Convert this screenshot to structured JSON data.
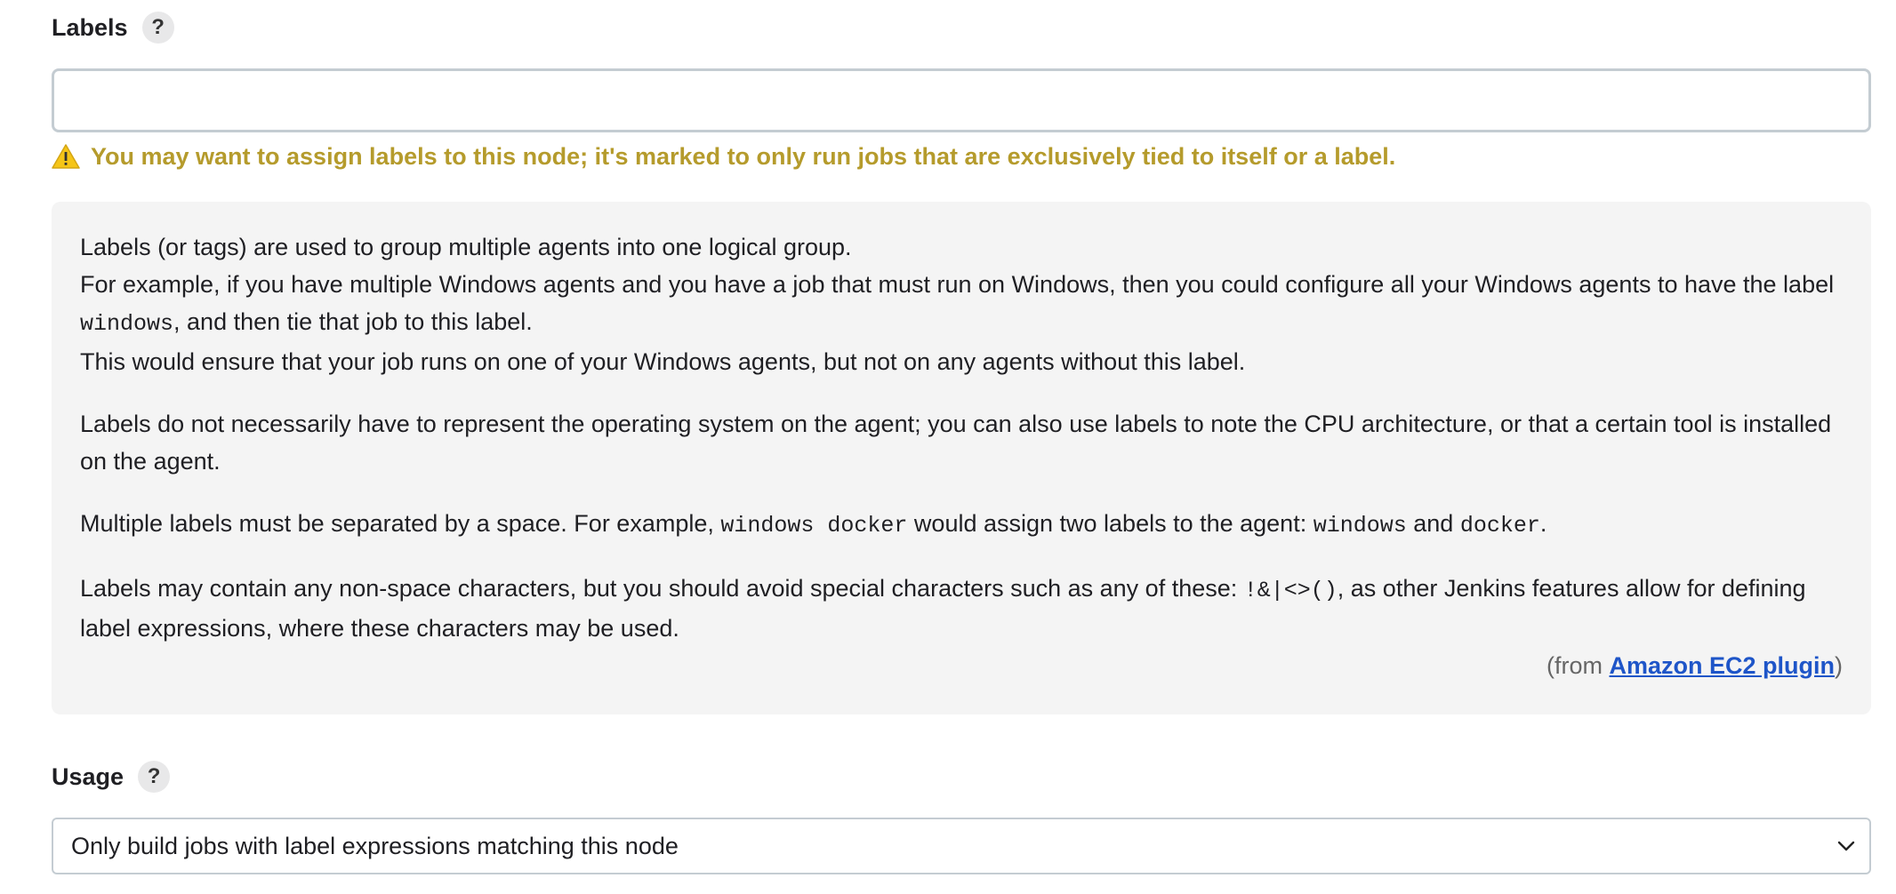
{
  "labels": {
    "title": "Labels",
    "help_glyph": "?",
    "input_value": "",
    "input_placeholder": "",
    "warning_icon": "warning-triangle-icon",
    "warning_text": "You may want to assign labels to this node; it's marked to only run jobs that are exclusively tied to itself or a label."
  },
  "help": {
    "p1_line1": "Labels (or tags) are used to group multiple agents into one logical group.",
    "p1_line2a": "For example, if you have multiple Windows agents and you have a job that must run on Windows, then you could configure all your Windows agents to have the label ",
    "p1_code": "windows",
    "p1_line2b": ", and then tie that job to this label.",
    "p1_line3": "This would ensure that your job runs on one of your Windows agents, but not on any agents without this label.",
    "p2": "Labels do not necessarily have to represent the operating system on the agent; you can also use labels to note the CPU architecture, or that a certain tool is installed on the agent.",
    "p3_a": "Multiple labels must be separated by a space. For example, ",
    "p3_code1": "windows docker",
    "p3_b": " would assign two labels to the agent: ",
    "p3_code2": "windows",
    "p3_c": " and ",
    "p3_code3": "docker",
    "p3_d": ".",
    "p4_a": "Labels may contain any non-space characters, but you should avoid special characters such as any of these: ",
    "p4_code": "!&|<>()",
    "p4_b": ", as other Jenkins features allow for defining label expressions, where these characters may be used.",
    "from_prefix": "(from ",
    "from_link": "Amazon EC2 plugin",
    "from_suffix": ")"
  },
  "usage": {
    "title": "Usage",
    "help_glyph": "?",
    "selected": "Only build jobs with label expressions matching this node",
    "chevron_icon": "chevron-down-icon"
  },
  "colors": {
    "warning": "#b59b2c",
    "link": "#1e55c8",
    "help_bg": "#f4f4f4"
  }
}
